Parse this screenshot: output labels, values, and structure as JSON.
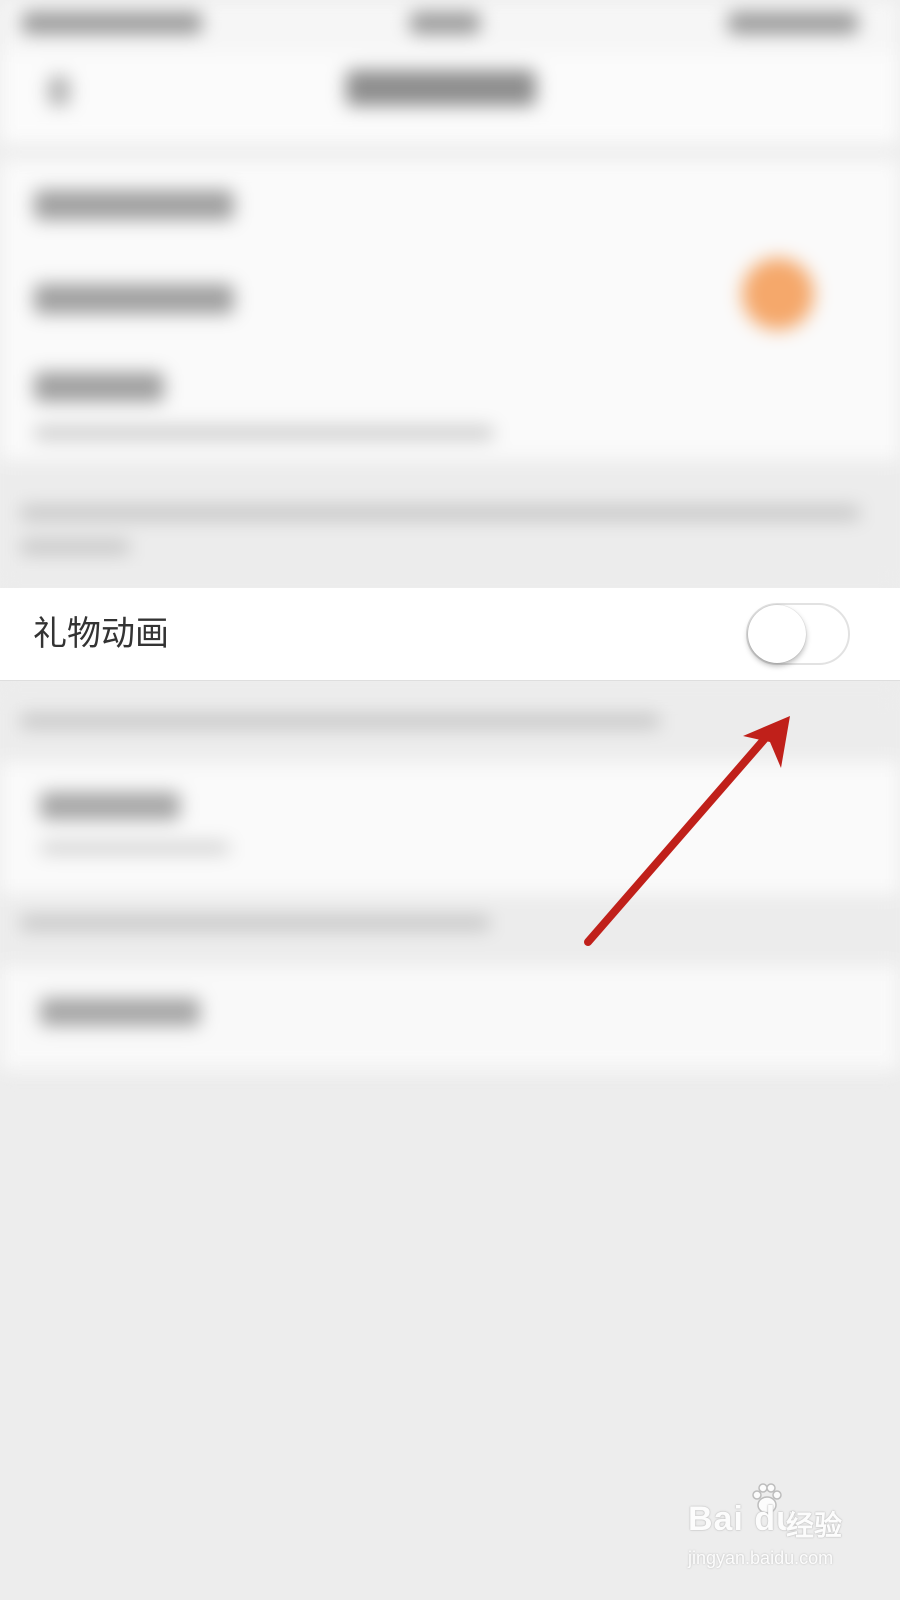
{
  "settings": {
    "gift_animation": {
      "label": "礼物动画",
      "enabled": false
    }
  },
  "annotation": {
    "arrow_color": "#c0201a",
    "arrow_icon": "red-arrow-icon"
  },
  "watermark": {
    "brand": "Bai du",
    "brand_cn": "经验",
    "url": "jingyan.baidu.com"
  },
  "colors": {
    "background": "#ededed",
    "row_background": "#ffffff",
    "accent_orange": "#f5a86b"
  }
}
